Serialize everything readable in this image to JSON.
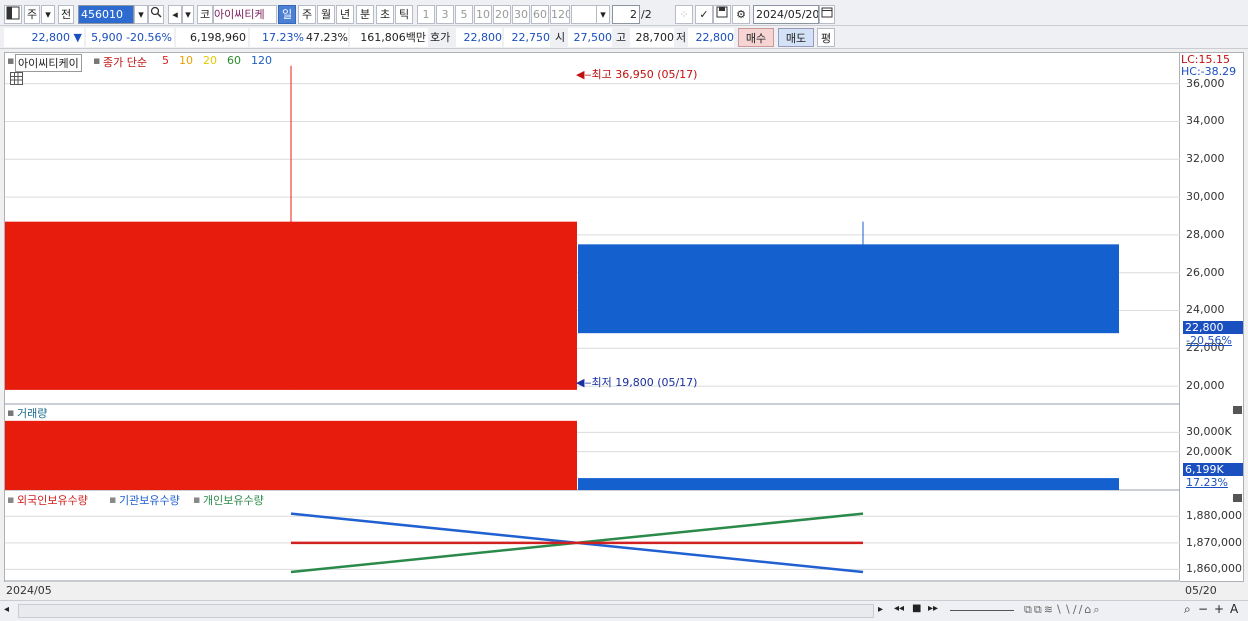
{
  "toolbar": {
    "period_label": "주",
    "prev_label": "전",
    "code_value": "456010",
    "market_label": "코",
    "stock_name": "아이씨티케",
    "tabs": [
      "일",
      "주",
      "월",
      "년",
      "분",
      "초",
      "틱"
    ],
    "active_tab": "일",
    "intervals": [
      "1",
      "3",
      "5",
      "10",
      "20",
      "30",
      "60",
      "120"
    ],
    "page_value": "2",
    "page_total": "/2",
    "date_value": "2024/05/20"
  },
  "info": {
    "price": "22,800",
    "change_arrow": "▼",
    "change": "5,900",
    "change_pct": "-20.56%",
    "volume": "6,198,960",
    "turnover_pct": "17.23%",
    "pct2": "47.23%",
    "amount": "161,806백만",
    "quote_label": "호가",
    "ask": "22,800",
    "bid": "22,750",
    "open_label": "시",
    "open": "27,500",
    "high_label": "고",
    "high": "28,700",
    "low_label": "저",
    "low": "22,800",
    "buy_label": "매수",
    "sell_label": "매도",
    "flat_label": "평"
  },
  "price_panel": {
    "title": "아이씨티케이",
    "indicator_label": "종가 단순",
    "ma_periods": [
      "5",
      "10",
      "20",
      "60",
      "120"
    ],
    "ma_colors": [
      "#e02020",
      "#e8a000",
      "#e6c800",
      "#2a8a2a",
      "#2060c0"
    ],
    "high_marker": "최고 36,950 (05/17)",
    "low_marker": "최저 19,800 (05/17)",
    "lc_label": "LC:15.15",
    "hc_label": "HC:-38.29",
    "y_ticks": [
      "36,000",
      "34,000",
      "32,000",
      "30,000",
      "28,000",
      "26,000",
      "24,000",
      "22,000",
      "20,000"
    ],
    "current_price": "22,800",
    "current_change": "-20.56%"
  },
  "volume_panel": {
    "title": "거래량",
    "y_ticks": [
      "30,000K",
      "20,000K"
    ],
    "current_volume": "6,199K",
    "current_pct": "17.23%"
  },
  "holdings_panel": {
    "legend": [
      "외국인보유수량",
      "기관보유수량",
      "개인보유수량"
    ],
    "legend_colors": [
      "#d02020",
      "#2060d0",
      "#2a8a4a"
    ],
    "y_ticks": [
      "1,880,000",
      "1,870,000",
      "1,860,000"
    ]
  },
  "x_axis": {
    "left_label": "2024/05",
    "right_label": "05/20"
  },
  "chart_data": {
    "type": "candlestick",
    "dates": [
      "05/17",
      "05/20"
    ],
    "candles": [
      {
        "date": "05/17",
        "open": 19800,
        "high": 36950,
        "low": 19800,
        "close": 28700
      },
      {
        "date": "05/20",
        "open": 27500,
        "high": 28700,
        "low": 22800,
        "close": 22800
      }
    ],
    "y_range": [
      19000,
      37200
    ],
    "volume": [
      {
        "date": "05/17",
        "value": 36000000
      },
      {
        "date": "05/20",
        "value": 6198960
      }
    ],
    "volume_range": [
      0,
      38000000
    ],
    "holdings": {
      "foreign": [
        1870000,
        1870000
      ],
      "institution": [
        1881000,
        1859000
      ],
      "individual": [
        1859000,
        1881000
      ]
    },
    "holdings_range": [
      1856000,
      1885000
    ]
  }
}
